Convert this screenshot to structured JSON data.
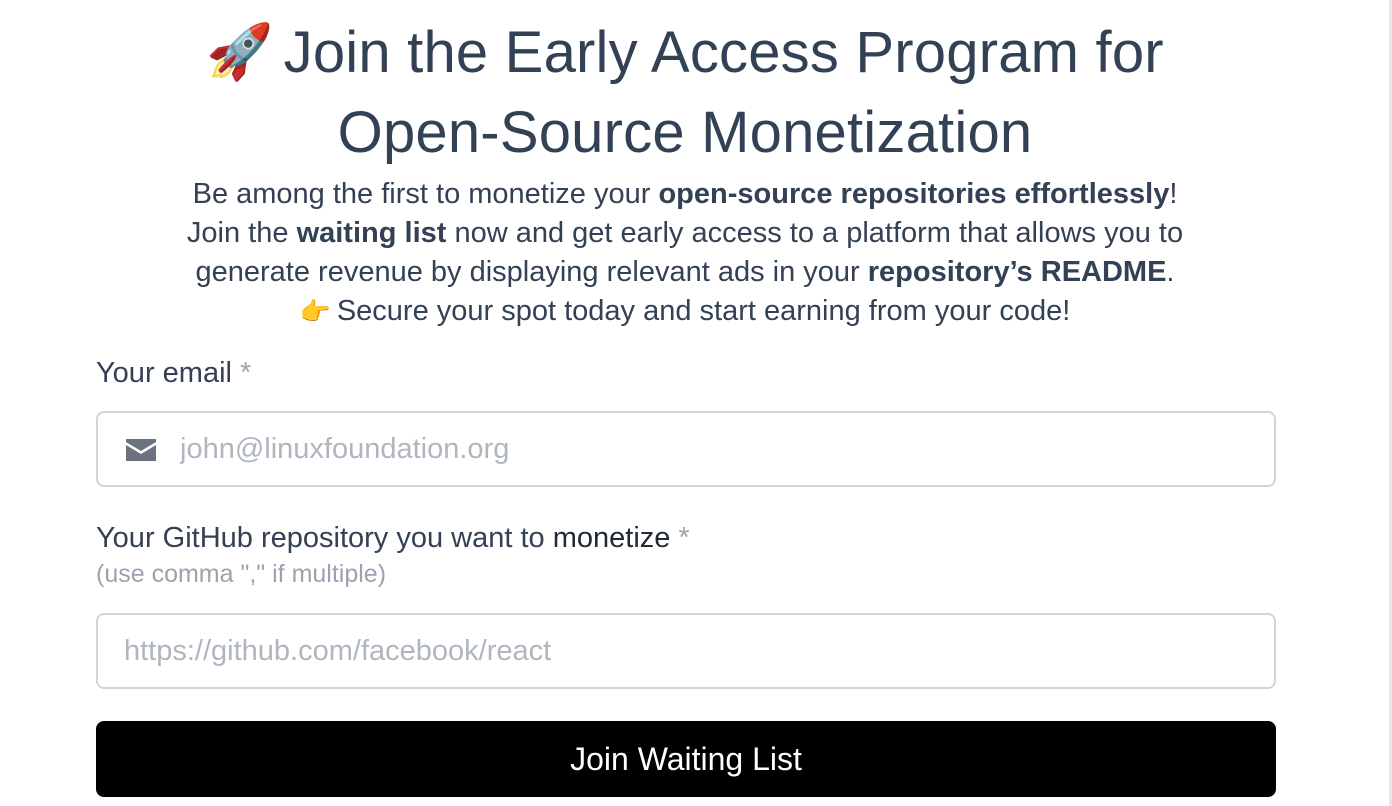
{
  "header": {
    "rocket_emoji": "🚀",
    "title_line1": "Join the Early Access Program for",
    "title_line2": "Open-Source Monetization",
    "intro": {
      "line1_a": "Be among the first to monetize your ",
      "line1_bold": "open-source repositories effortlessly",
      "line1_b": "!",
      "line2_a": "Join the ",
      "line2_bold": "waiting list",
      "line2_b": " now and get early access to a platform that allows you to",
      "line3_a": "generate revenue by displaying relevant ads in your ",
      "line3_bold": "repository’s README",
      "line3_b": ".",
      "point_emoji": "👉",
      "line4": "Secure your spot today and start earning from your code!"
    }
  },
  "form": {
    "email": {
      "label": "Your email",
      "required_mark": "*",
      "icon": "envelope-icon",
      "placeholder": "john@linuxfoundation.org",
      "value": ""
    },
    "repo": {
      "label_a": "Your GitHub repository you want to ",
      "label_strong": "monetize",
      "required_mark": "*",
      "hint": "(use comma \",\" if multiple)",
      "placeholder": "https://github.com/facebook/react",
      "value": ""
    },
    "submit_label": "Join Waiting List"
  },
  "colors": {
    "text": "#334155",
    "muted": "#9ca3af",
    "border": "#d1d5db",
    "button_bg": "#000000",
    "button_text": "#ffffff"
  }
}
